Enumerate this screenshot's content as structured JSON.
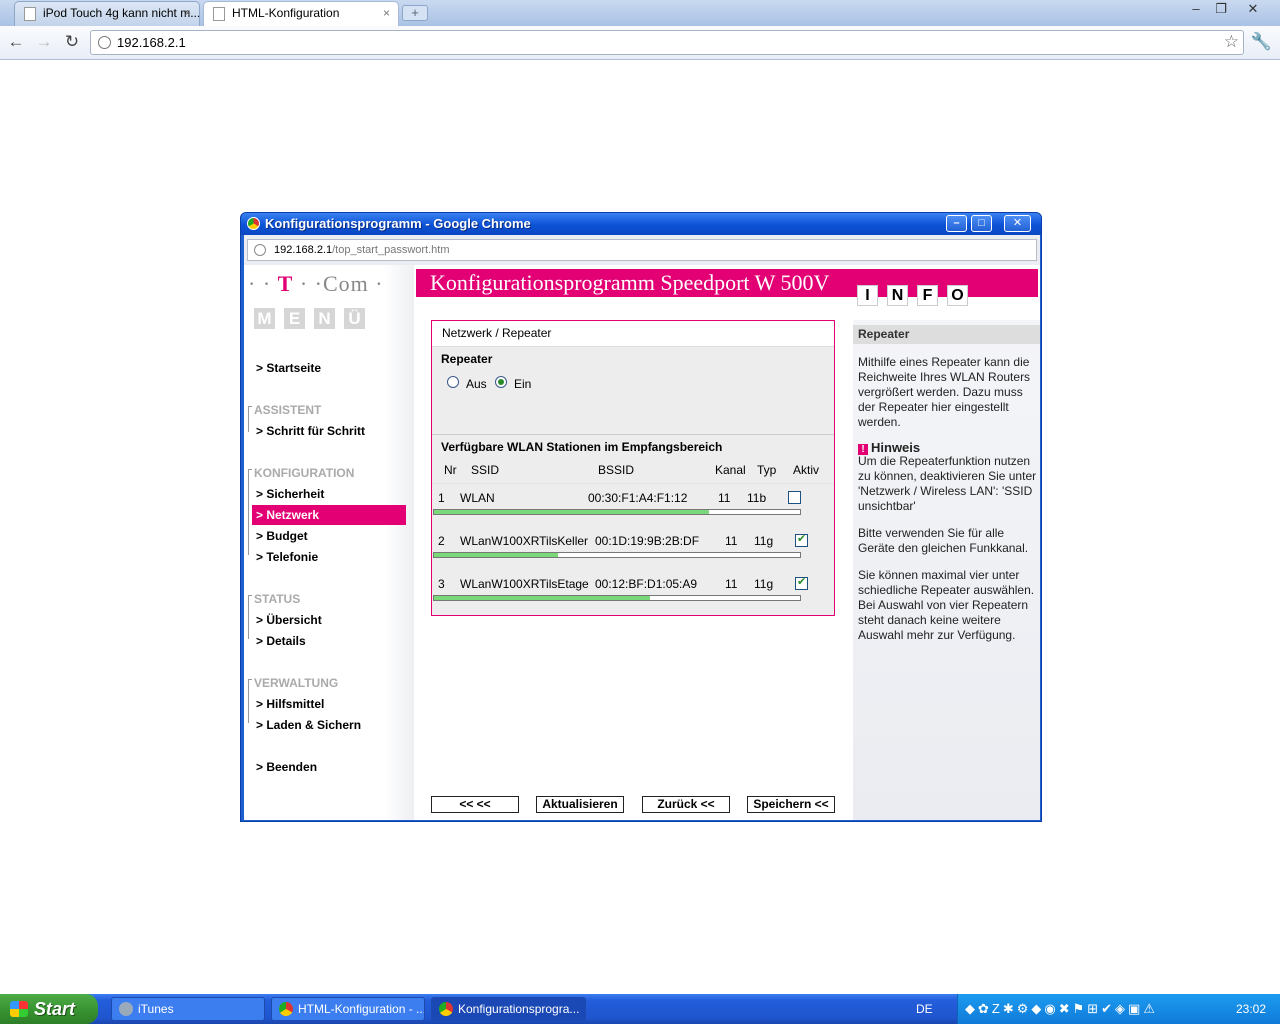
{
  "browser": {
    "tabs": [
      {
        "title": "iPod Touch 4g kann nicht m...",
        "close": "×"
      },
      {
        "title": "HTML-Konfiguration",
        "close": "×"
      }
    ],
    "newtab": "+",
    "controls": {
      "minimize": "–",
      "maximize": "❐",
      "close": "✕"
    },
    "nav": {
      "back": "←",
      "forward": "→",
      "reload": "↻"
    },
    "url": "192.168.2.1",
    "star": "☆",
    "wrench": "🔧"
  },
  "popup": {
    "title": "Konfigurationsprogramm - Google Chrome",
    "controls": {
      "minimize": "–",
      "maximize": "□",
      "close": "✕"
    },
    "address": {
      "host": "192.168.2.1",
      "path": "/top_start_passwort.htm"
    }
  },
  "logo": {
    "dots1": "· · ",
    "t": "T",
    "dots2": " · ·",
    "com": "Com",
    "dot3": " ·"
  },
  "menu_letters": [
    "M",
    "E",
    "N",
    "Ü"
  ],
  "info_letters": [
    "I",
    "N",
    "F",
    "O"
  ],
  "banner": {
    "title": "Konfigurationsprogramm Speedport W 500V"
  },
  "menu": {
    "startseite": "> Startseite",
    "assistent": {
      "heading": "ASSISTENT",
      "items": [
        "> Schritt für Schritt"
      ]
    },
    "konfiguration": {
      "heading": "KONFIGURATION",
      "items": [
        "> Sicherheit",
        "> Netzwerk",
        "> Budget",
        "> Telefonie"
      ],
      "active_index": 1
    },
    "status": {
      "heading": "STATUS",
      "items": [
        "> Übersicht",
        "> Details"
      ]
    },
    "verwaltung": {
      "heading": "VERWALTUNG",
      "items": [
        "> Hilfsmittel",
        "> Laden & Sichern"
      ]
    },
    "beenden": "> Beenden"
  },
  "content": {
    "breadcrumb": "Netzwerk / Repeater",
    "repeater_label": "Repeater",
    "radio": [
      {
        "label": "Aus",
        "checked": false
      },
      {
        "label": "Ein",
        "checked": true
      }
    ],
    "stations_title": "Verfügbare WLAN Stationen im Empfangsbereich",
    "columns": [
      "Nr",
      "SSID",
      "BSSID",
      "Kanal",
      "Typ",
      "Aktiv"
    ],
    "rows": [
      {
        "nr": "1",
        "ssid": "WLAN",
        "bssid": "00:30:F1:A4:F1:12",
        "kanal": "11",
        "typ": "11b",
        "aktiv": false,
        "signal": 0.75
      },
      {
        "nr": "2",
        "ssid": "WLanW100XRTilsKeller",
        "bssid": "00:1D:19:9B:2B:DF",
        "kanal": "11",
        "typ": "11g",
        "aktiv": true,
        "signal": 0.34
      },
      {
        "nr": "3",
        "ssid": "WLanW100XRTilsEtage",
        "bssid": "00:12:BF:D1:05:A9",
        "kanal": "11",
        "typ": "11g",
        "aktiv": true,
        "signal": 0.59
      }
    ]
  },
  "buttons": {
    "back_all": "<< <<",
    "refresh": "Aktualisieren",
    "back": "Zurück <<",
    "save": "Speichern <<"
  },
  "info": {
    "heading": "Repeater",
    "para1": "Mithilfe eines Repeater kann die Reichweite Ihres WLAN Routers vergrößert werden. Dazu muss der Repeater hier eingestellt werden.",
    "hint_icon": "!",
    "hint_title": "Hinweis",
    "para2": "Um die Repeaterfunktion nutzen zu können, deaktivieren Sie unter 'Netzwerk / Wireless LAN': 'SSID unsichtbar'",
    "para3": "Bitte verwenden Sie für alle Geräte den gleichen Funkkanal.",
    "para4": "Sie können maximal vier unter schiedliche Repeater auswählen. Bei Auswahl von vier Repeatern steht danach keine weitere Auswahl mehr zur Verfügung."
  },
  "taskbar": {
    "start": "Start",
    "tasks": [
      "iTunes",
      "HTML-Konfiguration - ...",
      "Konfigurationsprogra..."
    ],
    "lang": "DE",
    "tray_icons": "◆✿Z✱⚙◆◉✖⚑⊞✔◈▣⚠",
    "clock": "23:02"
  }
}
